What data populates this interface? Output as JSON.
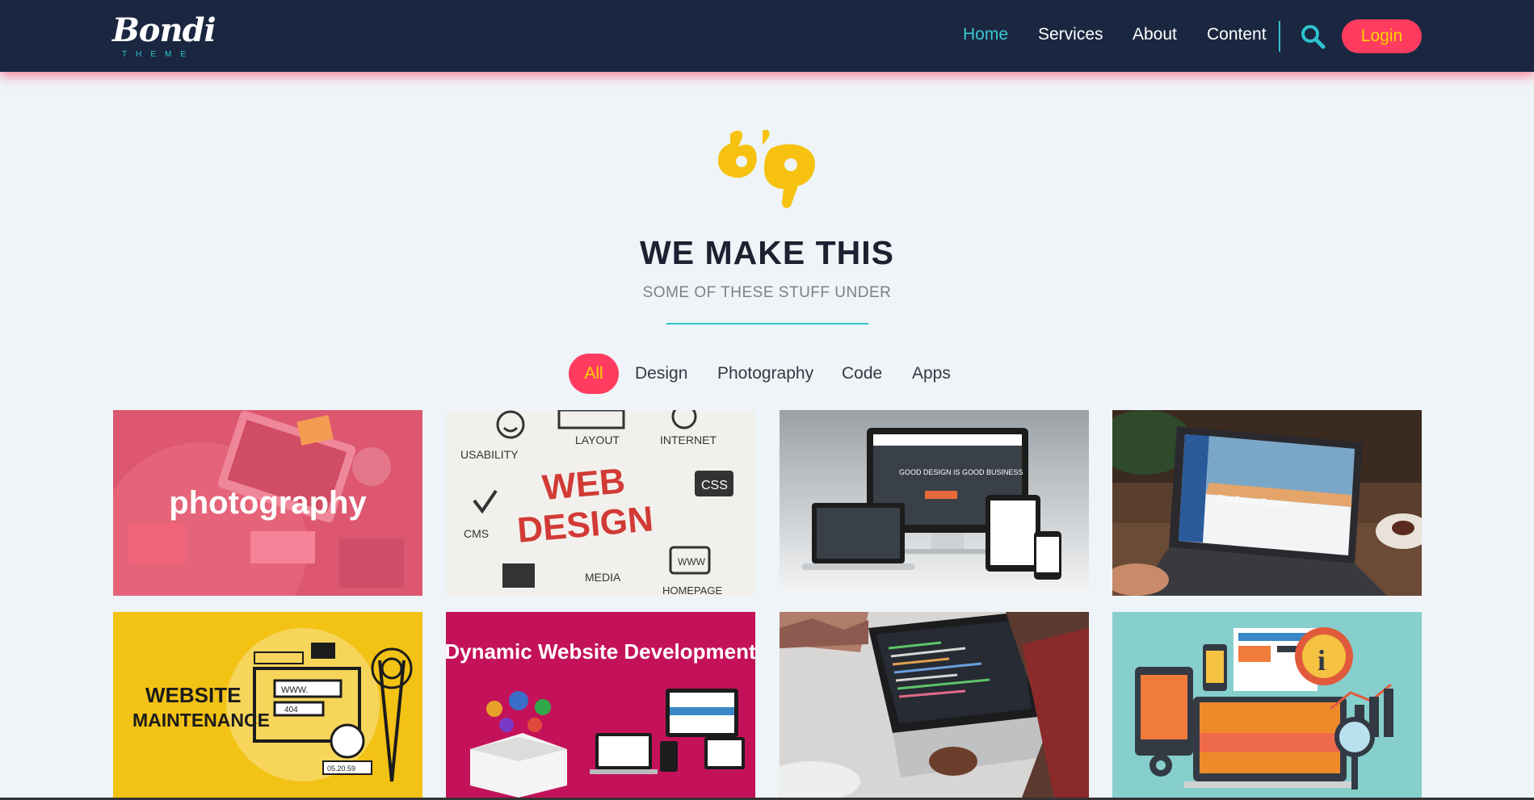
{
  "header": {
    "logo_text": "Bondi",
    "logo_sub": "THEME",
    "nav": [
      {
        "label": "Home",
        "active": true
      },
      {
        "label": "Services",
        "active": false
      },
      {
        "label": "About",
        "active": false
      },
      {
        "label": "Content",
        "active": false
      }
    ],
    "search_icon": "search-icon",
    "login_label": "Login"
  },
  "hero": {
    "icon": "sign-language-hands-icon",
    "title": "WE MAKE THIS",
    "subtitle": "SOME OF THESE STUFF UNDER"
  },
  "filters": [
    {
      "label": "All",
      "active": true
    },
    {
      "label": "Design",
      "active": false
    },
    {
      "label": "Photography",
      "active": false
    },
    {
      "label": "Code",
      "active": false
    },
    {
      "label": "Apps",
      "active": false
    }
  ],
  "portfolio": [
    {
      "overlay": "photography"
    },
    {
      "labels": [
        "USABILITY",
        "LAYOUT",
        "INTERNET",
        "WEB",
        "DESIGN",
        "CSS",
        "CMS",
        "MEDIA",
        "WWW",
        "HOMEPAGE"
      ]
    },
    {
      "labels": [
        "GOOD DESIGN IS GOOD BUSINESS"
      ]
    },
    {
      "labels": [
        "The Pump Experts"
      ]
    },
    {
      "labels": [
        "WEBSITE",
        "MAINTENANCE",
        "WWW.",
        "404",
        "05.20.59"
      ]
    },
    {
      "labels": [
        "Dynamic Website Development"
      ]
    },
    {
      "labels": []
    },
    {
      "labels": []
    }
  ],
  "colors": {
    "header_bg": "#1b2740",
    "accent_cyan": "#2fc2cf",
    "accent_pink": "#ff3c5f",
    "accent_yellow": "#ffd400",
    "page_bg": "#eef4f7"
  }
}
